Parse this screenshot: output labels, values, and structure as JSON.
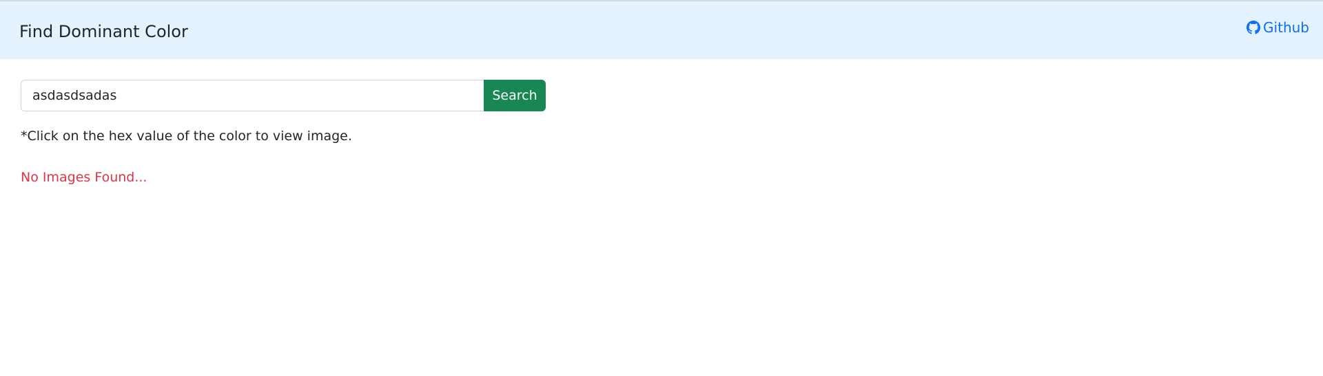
{
  "navbar": {
    "brand": "Find Dominant Color",
    "github_label": "Github",
    "github_icon": "github-icon"
  },
  "search": {
    "value": "asdasdsadas",
    "button_label": "Search"
  },
  "hint": "*Click on the hex value of the color to view image.",
  "status": "No Images Found...",
  "colors": {
    "navbar_bg": "#e3f2fd",
    "link": "#0d6efd",
    "button": "#198754",
    "error": "#dc3545"
  }
}
